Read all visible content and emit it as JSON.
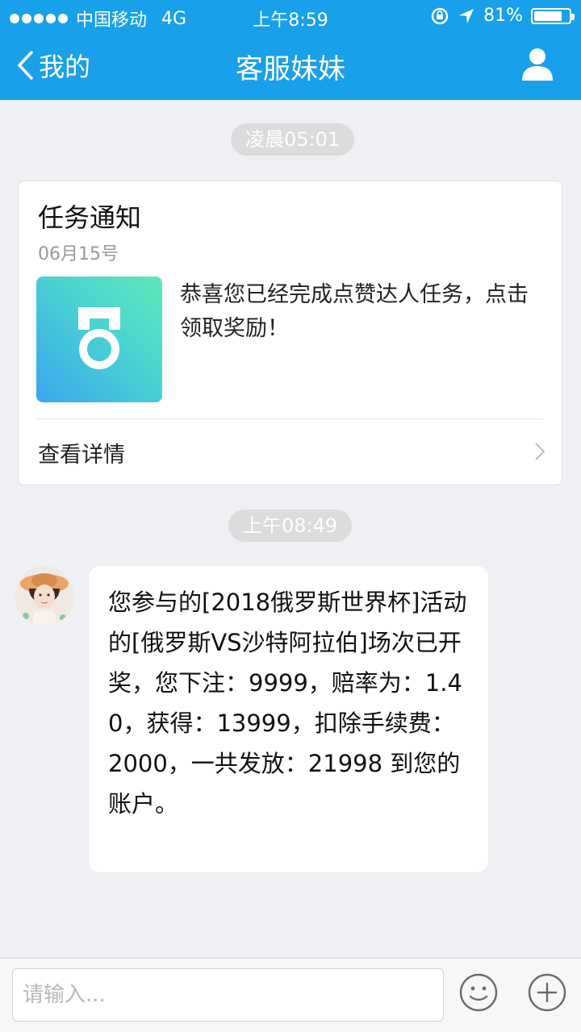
{
  "status_bar": {
    "carrier": "中国移动",
    "network": "4G",
    "time": "上午8:59",
    "battery_percent": "81%",
    "battery_level": 0.81
  },
  "nav": {
    "back_label": "我的",
    "title": "客服妹妹"
  },
  "timestamps": [
    "凌晨05:01",
    "上午08:49"
  ],
  "card": {
    "title": "任务通知",
    "date": "06月15号",
    "message": "恭喜您已经完成点赞达人任务，点击领取奖励！",
    "detail_label": "查看详情"
  },
  "chat": {
    "message": "您参与的[2018俄罗斯世界杯]活动的[俄罗斯VS沙特阿拉伯]场次已开奖，您下注：9999，赔率为：1.40，获得：13999，扣除手续费：2000，一共发放：21998 到您的账户。"
  },
  "input": {
    "placeholder": "请输入..."
  },
  "colors": {
    "brand": "#19a0ea",
    "background": "#efeff4"
  }
}
